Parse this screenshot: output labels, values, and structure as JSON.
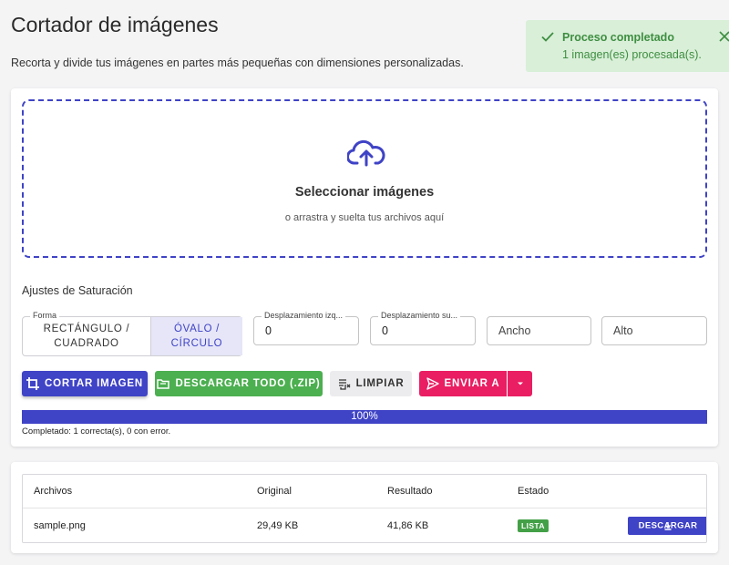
{
  "header": {
    "title": "Cortador de imágenes",
    "subtitle": "Recorta y divide tus imágenes en partes más pequeñas con dimensiones personalizadas."
  },
  "toast": {
    "title": "Proceso completado",
    "message": "1 imagen(es) procesada(s).",
    "color": "#3e8e41"
  },
  "dropzone": {
    "title": "Seleccionar imágenes",
    "subtitle": "o arrastra y suelta tus archivos aquí",
    "icon": "cloud-upload-icon"
  },
  "settings": {
    "label": "Ajustes de Saturación",
    "shape": {
      "legend": "Forma",
      "options": [
        "RECTÁNGULO / CUADRADO",
        "ÓVALO / CÍRCULO"
      ],
      "selected": "ÓVALO / CÍRCULO"
    },
    "offset_x": {
      "label": "Desplazamiento izq...",
      "value": "0"
    },
    "offset_y": {
      "label": "Desplazamiento su...",
      "value": "0"
    },
    "width": {
      "placeholder": "Ancho"
    },
    "height": {
      "placeholder": "Alto"
    }
  },
  "actions": {
    "cut": "CORTAR IMAGEN",
    "download_all": "DESCARGAR TODO (.ZIP)",
    "clear": "LIMPIAR",
    "send": "ENVIAR A"
  },
  "progress": {
    "percent": 100,
    "label": "100%",
    "status": "Completado: 1 correcta(s), 0 con error."
  },
  "table": {
    "headers": [
      "Archivos",
      "Original",
      "Resultado",
      "Estado"
    ],
    "rows": [
      {
        "file": "sample.png",
        "original": "29,49 KB",
        "result": "41,86 KB",
        "status": "LISTA",
        "action": "DESCARGAR"
      }
    ]
  },
  "colors": {
    "primary": "#3f43c6",
    "success": "#4caf50",
    "accent": "#e91e63",
    "badge": "#43a047"
  }
}
